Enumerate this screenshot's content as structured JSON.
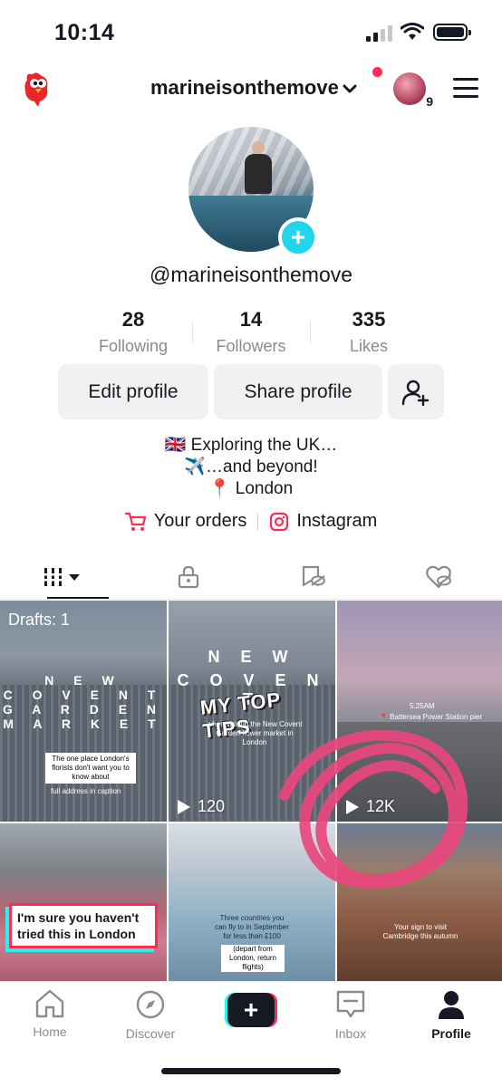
{
  "status_bar": {
    "time": "10:14"
  },
  "header": {
    "username": "marineisonthemove",
    "notification_count": "9"
  },
  "profile": {
    "handle": "@marineisonthemove",
    "stats": [
      {
        "num": "28",
        "label": "Following"
      },
      {
        "num": "14",
        "label": "Followers"
      },
      {
        "num": "335",
        "label": "Likes"
      }
    ],
    "buttons": {
      "edit": "Edit profile",
      "share": "Share profile"
    },
    "bio": [
      "🇬🇧 Exploring the UK…",
      "✈️…and beyond!",
      "📍 London"
    ],
    "links": {
      "orders": "Your orders",
      "instagram": "Instagram"
    }
  },
  "grid": {
    "drafts_label": "Drafts: 1",
    "videos": [
      {
        "views": "",
        "sign": [
          "N E W",
          "C O V E N T",
          "G A R D E N",
          "M A R K E T"
        ],
        "caption": "The one place London's florists don't want you to know about",
        "subcaption": "full address in caption"
      },
      {
        "views": "120",
        "sign": [
          "N E W",
          "C O V E N T",
          "G",
          "M"
        ],
        "overlay": "MY TOP TIPS",
        "caption": "when visiting the New Covent Garden flower market in London"
      },
      {
        "views": "12K",
        "caption": "5:25AM",
        "location": "📍 Battersea Power Station pier"
      },
      {
        "views": "",
        "caption": "I'm sure you haven't tried this in London"
      },
      {
        "views": "",
        "caption": "Three countries you can fly to in September for less than £100",
        "subcaption": "(depart from London, return flights)"
      },
      {
        "views": "",
        "caption": "Your sign to visit Cambridge this autumn"
      }
    ]
  },
  "bottom_nav": [
    {
      "label": "Home"
    },
    {
      "label": "Discover"
    },
    {
      "label": ""
    },
    {
      "label": "Inbox"
    },
    {
      "label": "Profile"
    }
  ],
  "colors": {
    "accent_pink": "#fe2c55",
    "accent_cyan": "#25f4ee",
    "follow_plus": "#20d5ec",
    "annotation": "#e8467c"
  }
}
